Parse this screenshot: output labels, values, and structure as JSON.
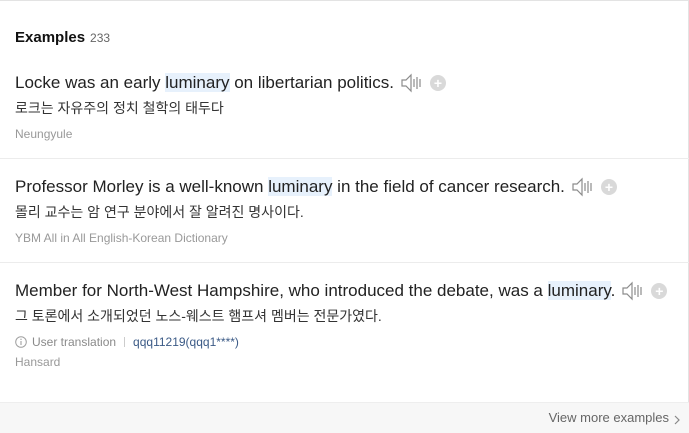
{
  "examples_section": {
    "title": "Examples",
    "count": "233"
  },
  "examples": [
    {
      "en_before": "Locke was an early ",
      "en_highlight": "luminary",
      "en_after": " on libertarian politics.",
      "ko": "로크는 자유주의 정치 철학의 태두다",
      "source": "Neungyule"
    },
    {
      "en_before": "Professor Morley is a well-known ",
      "en_highlight": "luminary",
      "en_after": " in the field of cancer research.",
      "ko": "몰리 교수는 암 연구 분야에서 잘 알려진 명사이다.",
      "source": "YBM All in All English-Korean Dictionary"
    },
    {
      "en_before": "Member for North-West Hampshire, who introduced the debate, was a ",
      "en_highlight": "luminary",
      "en_after": ".",
      "ko": "그 토론에서 소개되었던 노스-웨스트 햄프셔 멤버는 전문가였다.",
      "user_translation_label": "User translation",
      "user_id": "qqq11219(qqq1****)",
      "source": "Hansard"
    }
  ],
  "footer": {
    "view_more_label": "View more examples"
  },
  "icons": {
    "speaker": "speaker-icon",
    "add": "plus-circle-icon",
    "info": "info-icon",
    "chevron": "chevron-right-icon"
  },
  "colors": {
    "highlight_bg": "#e7f1fc",
    "user_link": "#3b5a86",
    "muted_text": "#999999"
  }
}
